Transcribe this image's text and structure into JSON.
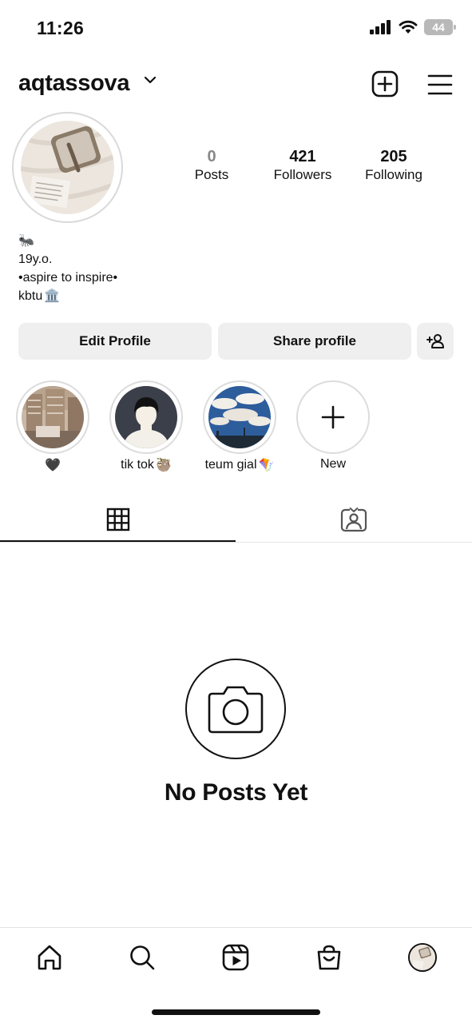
{
  "status_bar": {
    "time": "11:26",
    "battery": "44"
  },
  "header": {
    "username": "aqtassova"
  },
  "stats": [
    {
      "value": "0",
      "label": "Posts"
    },
    {
      "value": "421",
      "label": "Followers"
    },
    {
      "value": "205",
      "label": "Following"
    }
  ],
  "bio": {
    "line1_emoji": "🐜",
    "line2": "19y.o.",
    "line3": "•aspire to inspire•",
    "line4": "kbtu",
    "line4_emoji": "🏛️"
  },
  "buttons": {
    "edit": "Edit Profile",
    "share": "Share profile"
  },
  "highlights": [
    {
      "label": "🖤"
    },
    {
      "label": "tik tok",
      "emoji": "🦥"
    },
    {
      "label": "teum gial",
      "emoji": "🪁"
    },
    {
      "label": "New"
    }
  ],
  "empty_state": {
    "title": "No Posts Yet"
  },
  "colors": {
    "button_bg": "#efefef",
    "text": "#111111",
    "muted": "#888888"
  }
}
